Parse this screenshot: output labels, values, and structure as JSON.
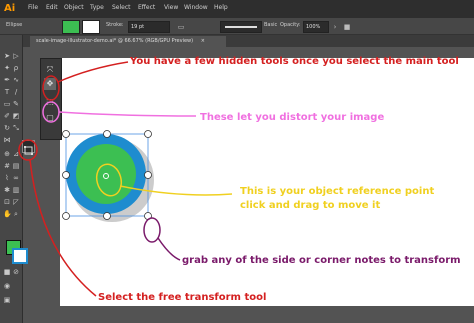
{
  "app": {
    "logo": "Ai",
    "menu": [
      "File",
      "Edit",
      "Object",
      "Type",
      "Select",
      "Effect",
      "View",
      "Window",
      "Help"
    ]
  },
  "control_bar": {
    "object_type": "Ellipse",
    "stroke_label": "Stroke:",
    "stroke_weight": "19 pt",
    "brush": "Basic",
    "opacity_label": "Opacity:",
    "opacity_value": "100%",
    "fill_color": "#3cbf52",
    "stroke_color": "#ffffff"
  },
  "document": {
    "tab_title": "scale-image-illustrator-demo.ai* @ 66.67% (RGB/GPU Preview)",
    "close_symbol": "×"
  },
  "toolbar": {
    "fill_color": "#3cbf52",
    "stroke_color": "#1e8ccf"
  },
  "annotations": {
    "hidden_tools": "You have a few hidden tools once you select the main tool",
    "distort": "These let you distort your image",
    "reference_line1": "This is your object reference point",
    "reference_line2": "click and drag to move it",
    "grab_nodes": "grab any of the side or corner notes to transform",
    "free_transform": "Select the free transform tool"
  },
  "colors": {
    "red": "#d42020",
    "pink": "#f070e0",
    "yellow": "#f0d020",
    "purple": "#7a1a6a",
    "circle_outer": "#1e8ccf",
    "circle_inner": "#3cbf52"
  }
}
